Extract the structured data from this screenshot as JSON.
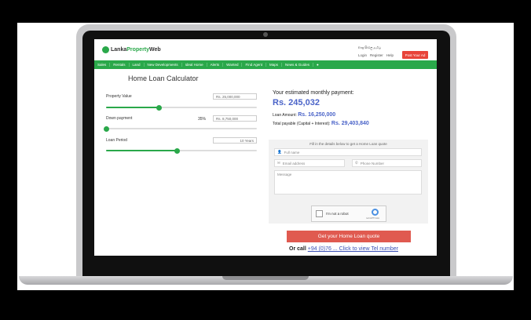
{
  "site": {
    "logo_prefix": "Lanka",
    "logo_brand": "Property",
    "logo_suffix": "Web",
    "languages": "Eng  සිංහල  தமிழ்",
    "links": [
      "Login",
      "Register",
      "Help"
    ],
    "post_ad": "Post Your Ad"
  },
  "nav": [
    "Sales",
    "Rentals",
    "Land",
    "New Developments",
    "Ideal Home",
    "Alerts",
    "Wanted",
    "Find Agent",
    "Maps",
    "News & Guides",
    "●"
  ],
  "calculator": {
    "title": "Home Loan Calculator",
    "property_value": {
      "label": "Property Value",
      "value": "Rs. 25,000,000",
      "level_percent": 35
    },
    "down_payment": {
      "label": "Down payment",
      "percent": "35%",
      "value": "Rs. 8,750,000",
      "level_percent": 0
    },
    "loan_period": {
      "label": "Loan Period",
      "value": "10 Years",
      "level_percent": 47
    }
  },
  "result": {
    "heading": "Your estimated monthly payment:",
    "monthly": "Rs. 245,032",
    "loan_amount_label": "Loan Amount:",
    "loan_amount": "Rs. 16,250,000",
    "total_label": "Total payable (Capital + Interest):",
    "total": "Rs. 29,403,840"
  },
  "form": {
    "hint": "Fill in the details below to get a Home Loan quote",
    "full_name_placeholder": "Full name",
    "email_placeholder": "Email address",
    "phone_placeholder": "Phone Number",
    "message_placeholder": "Message",
    "captcha_text": "I'm not a robot",
    "captcha_brand": "reCAPTCHA",
    "submit": "Get your Home Loan quote"
  },
  "call": {
    "prefix": "Or call",
    "number": "+94 (0)76 ... Click to view Tel number"
  },
  "colors": {
    "accent_green": "#2aa84a",
    "primary_blue": "#4a63c8",
    "cta_red": "#e05a50"
  }
}
